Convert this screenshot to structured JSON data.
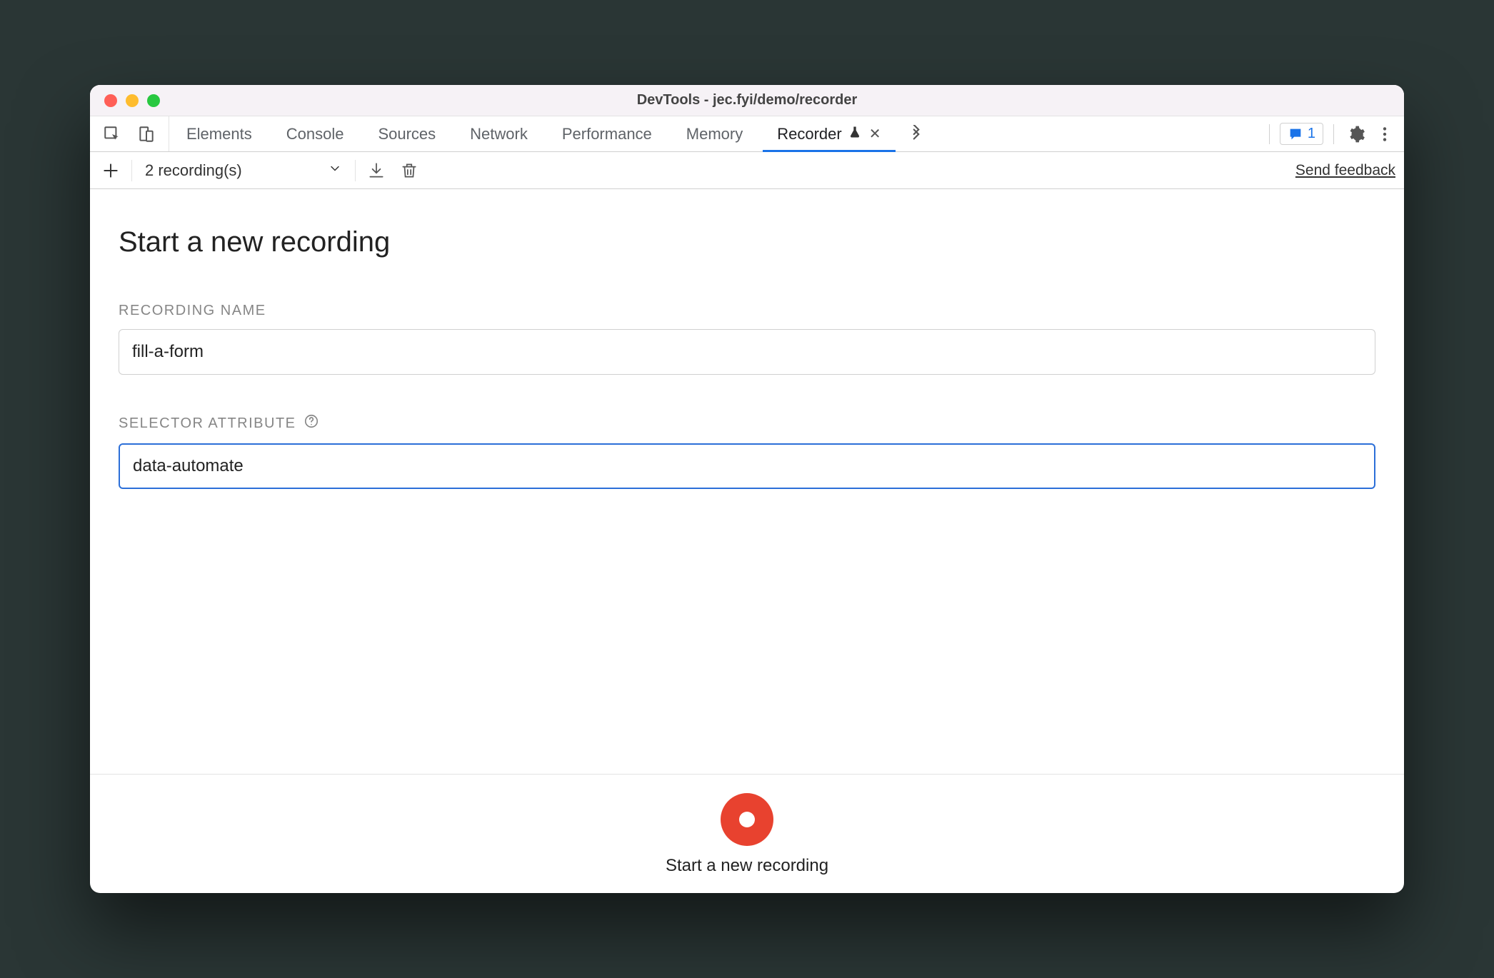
{
  "window": {
    "title": "DevTools - jec.fyi/demo/recorder"
  },
  "tabs": {
    "items": [
      {
        "label": "Elements",
        "active": false
      },
      {
        "label": "Console",
        "active": false
      },
      {
        "label": "Sources",
        "active": false
      },
      {
        "label": "Network",
        "active": false
      },
      {
        "label": "Performance",
        "active": false
      },
      {
        "label": "Memory",
        "active": false
      },
      {
        "label": "Recorder",
        "active": true,
        "experimental": true,
        "closable": true
      }
    ],
    "issues_count": "1"
  },
  "toolbar": {
    "recordings_label": "2 recording(s)",
    "feedback_label": "Send feedback"
  },
  "page": {
    "title": "Start a new recording",
    "recording_name_label": "RECORDING NAME",
    "recording_name_value": "fill-a-form",
    "selector_attr_label": "SELECTOR ATTRIBUTE",
    "selector_attr_value": "data-automate"
  },
  "footer": {
    "record_label": "Start a new recording"
  }
}
